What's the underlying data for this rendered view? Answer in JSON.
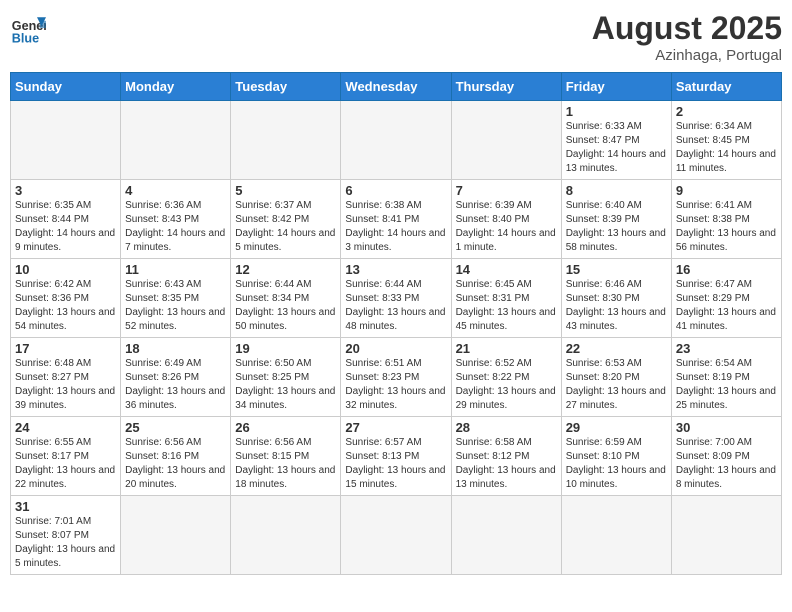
{
  "header": {
    "logo_general": "General",
    "logo_blue": "Blue",
    "month_title": "August 2025",
    "subtitle": "Azinhaga, Portugal"
  },
  "weekdays": [
    "Sunday",
    "Monday",
    "Tuesday",
    "Wednesday",
    "Thursday",
    "Friday",
    "Saturday"
  ],
  "weeks": [
    [
      {
        "day": "",
        "info": ""
      },
      {
        "day": "",
        "info": ""
      },
      {
        "day": "",
        "info": ""
      },
      {
        "day": "",
        "info": ""
      },
      {
        "day": "",
        "info": ""
      },
      {
        "day": "1",
        "info": "Sunrise: 6:33 AM\nSunset: 8:47 PM\nDaylight: 14 hours and 13 minutes."
      },
      {
        "day": "2",
        "info": "Sunrise: 6:34 AM\nSunset: 8:45 PM\nDaylight: 14 hours and 11 minutes."
      }
    ],
    [
      {
        "day": "3",
        "info": "Sunrise: 6:35 AM\nSunset: 8:44 PM\nDaylight: 14 hours and 9 minutes."
      },
      {
        "day": "4",
        "info": "Sunrise: 6:36 AM\nSunset: 8:43 PM\nDaylight: 14 hours and 7 minutes."
      },
      {
        "day": "5",
        "info": "Sunrise: 6:37 AM\nSunset: 8:42 PM\nDaylight: 14 hours and 5 minutes."
      },
      {
        "day": "6",
        "info": "Sunrise: 6:38 AM\nSunset: 8:41 PM\nDaylight: 14 hours and 3 minutes."
      },
      {
        "day": "7",
        "info": "Sunrise: 6:39 AM\nSunset: 8:40 PM\nDaylight: 14 hours and 1 minute."
      },
      {
        "day": "8",
        "info": "Sunrise: 6:40 AM\nSunset: 8:39 PM\nDaylight: 13 hours and 58 minutes."
      },
      {
        "day": "9",
        "info": "Sunrise: 6:41 AM\nSunset: 8:38 PM\nDaylight: 13 hours and 56 minutes."
      }
    ],
    [
      {
        "day": "10",
        "info": "Sunrise: 6:42 AM\nSunset: 8:36 PM\nDaylight: 13 hours and 54 minutes."
      },
      {
        "day": "11",
        "info": "Sunrise: 6:43 AM\nSunset: 8:35 PM\nDaylight: 13 hours and 52 minutes."
      },
      {
        "day": "12",
        "info": "Sunrise: 6:44 AM\nSunset: 8:34 PM\nDaylight: 13 hours and 50 minutes."
      },
      {
        "day": "13",
        "info": "Sunrise: 6:44 AM\nSunset: 8:33 PM\nDaylight: 13 hours and 48 minutes."
      },
      {
        "day": "14",
        "info": "Sunrise: 6:45 AM\nSunset: 8:31 PM\nDaylight: 13 hours and 45 minutes."
      },
      {
        "day": "15",
        "info": "Sunrise: 6:46 AM\nSunset: 8:30 PM\nDaylight: 13 hours and 43 minutes."
      },
      {
        "day": "16",
        "info": "Sunrise: 6:47 AM\nSunset: 8:29 PM\nDaylight: 13 hours and 41 minutes."
      }
    ],
    [
      {
        "day": "17",
        "info": "Sunrise: 6:48 AM\nSunset: 8:27 PM\nDaylight: 13 hours and 39 minutes."
      },
      {
        "day": "18",
        "info": "Sunrise: 6:49 AM\nSunset: 8:26 PM\nDaylight: 13 hours and 36 minutes."
      },
      {
        "day": "19",
        "info": "Sunrise: 6:50 AM\nSunset: 8:25 PM\nDaylight: 13 hours and 34 minutes."
      },
      {
        "day": "20",
        "info": "Sunrise: 6:51 AM\nSunset: 8:23 PM\nDaylight: 13 hours and 32 minutes."
      },
      {
        "day": "21",
        "info": "Sunrise: 6:52 AM\nSunset: 8:22 PM\nDaylight: 13 hours and 29 minutes."
      },
      {
        "day": "22",
        "info": "Sunrise: 6:53 AM\nSunset: 8:20 PM\nDaylight: 13 hours and 27 minutes."
      },
      {
        "day": "23",
        "info": "Sunrise: 6:54 AM\nSunset: 8:19 PM\nDaylight: 13 hours and 25 minutes."
      }
    ],
    [
      {
        "day": "24",
        "info": "Sunrise: 6:55 AM\nSunset: 8:17 PM\nDaylight: 13 hours and 22 minutes."
      },
      {
        "day": "25",
        "info": "Sunrise: 6:56 AM\nSunset: 8:16 PM\nDaylight: 13 hours and 20 minutes."
      },
      {
        "day": "26",
        "info": "Sunrise: 6:56 AM\nSunset: 8:15 PM\nDaylight: 13 hours and 18 minutes."
      },
      {
        "day": "27",
        "info": "Sunrise: 6:57 AM\nSunset: 8:13 PM\nDaylight: 13 hours and 15 minutes."
      },
      {
        "day": "28",
        "info": "Sunrise: 6:58 AM\nSunset: 8:12 PM\nDaylight: 13 hours and 13 minutes."
      },
      {
        "day": "29",
        "info": "Sunrise: 6:59 AM\nSunset: 8:10 PM\nDaylight: 13 hours and 10 minutes."
      },
      {
        "day": "30",
        "info": "Sunrise: 7:00 AM\nSunset: 8:09 PM\nDaylight: 13 hours and 8 minutes."
      }
    ],
    [
      {
        "day": "31",
        "info": "Sunrise: 7:01 AM\nSunset: 8:07 PM\nDaylight: 13 hours and 5 minutes."
      },
      {
        "day": "",
        "info": ""
      },
      {
        "day": "",
        "info": ""
      },
      {
        "day": "",
        "info": ""
      },
      {
        "day": "",
        "info": ""
      },
      {
        "day": "",
        "info": ""
      },
      {
        "day": "",
        "info": ""
      }
    ]
  ]
}
